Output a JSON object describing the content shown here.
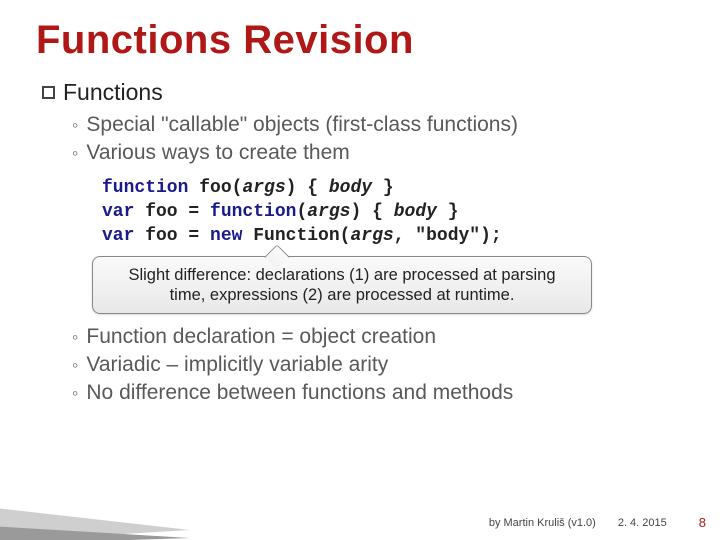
{
  "title": "Functions Revision",
  "section": "Functions",
  "bullets_top": [
    "Special \"callable\" objects (first-class functions)",
    "Various ways to create them"
  ],
  "code": {
    "l1": {
      "kw1": "function",
      "a": " foo(",
      "it1": "args",
      "b": ") { ",
      "it2": "body",
      "c": " }"
    },
    "l2": {
      "kw1": "var",
      "a": " foo = ",
      "kw2": "function",
      "b": "(",
      "it1": "args",
      "c": ") { ",
      "it2": "body",
      "d": " }"
    },
    "l3": {
      "kw1": "var",
      "a": " foo = ",
      "kw2": "new",
      "b": " Function(",
      "it1": "args",
      "c": ", ",
      "str": "\"body\"",
      "d": ");"
    }
  },
  "callout": "Slight difference: declarations (1) are processed at parsing time, expressions (2) are processed at runtime.",
  "bullets_bottom": [
    "Function declaration = object creation",
    "Variadic – implicitly variable arity",
    "No difference between functions and methods"
  ],
  "footer": {
    "author": "by Martin Kruliš (v1.0)",
    "date": "2. 4. 2015",
    "page": "8"
  }
}
